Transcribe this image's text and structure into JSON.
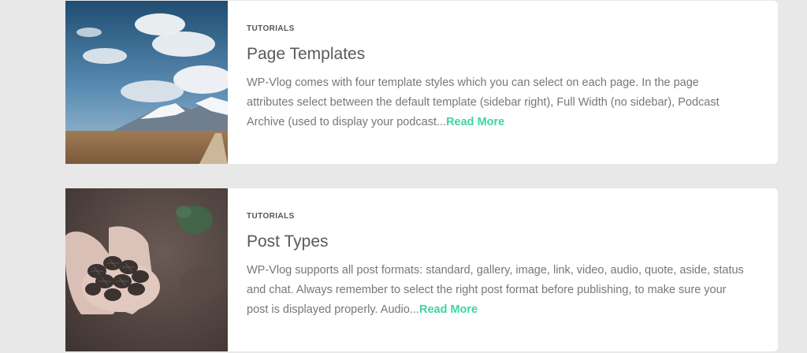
{
  "posts": [
    {
      "category": "TUTORIALS",
      "title": "Page Templates",
      "excerpt": "WP-Vlog comes with four template styles which you can select on each page. In the page attributes select between the default template (sidebar right), Full Width (no sidebar), Podcast Archive (used to display your podcast...",
      "read_more": "Read More",
      "image": "mountain-landscape-photo"
    },
    {
      "category": "TUTORIALS",
      "title": "Post Types",
      "excerpt": "WP-Vlog supports all post formats: standard, gallery, image, link, video, audio, quote, aside, status and chat.  Always remember to select the right post format before publishing, to make sure your post is displayed properly. Audio...",
      "read_more": "Read More",
      "image": "hands-holding-pinecones-photo"
    }
  ],
  "colors": {
    "background": "#e8e8e8",
    "card": "#ffffff",
    "accent": "#3fd4a4",
    "title": "#5a5a5a",
    "text": "#777777"
  }
}
